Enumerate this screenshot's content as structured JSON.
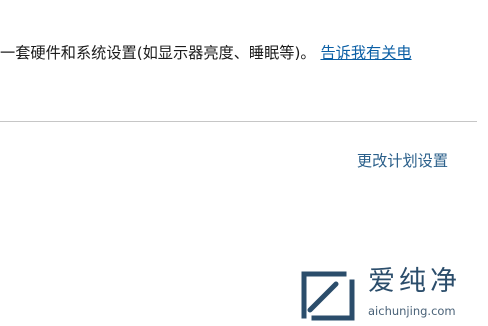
{
  "description": {
    "text": "一套硬件和系统设置(如显示器亮度、睡眠等)。",
    "link_label": "告诉我有关电"
  },
  "actions": {
    "change_plan_settings": "更改计划设置"
  },
  "watermark": {
    "title": "爱纯净",
    "url": "aichunjing.com"
  }
}
